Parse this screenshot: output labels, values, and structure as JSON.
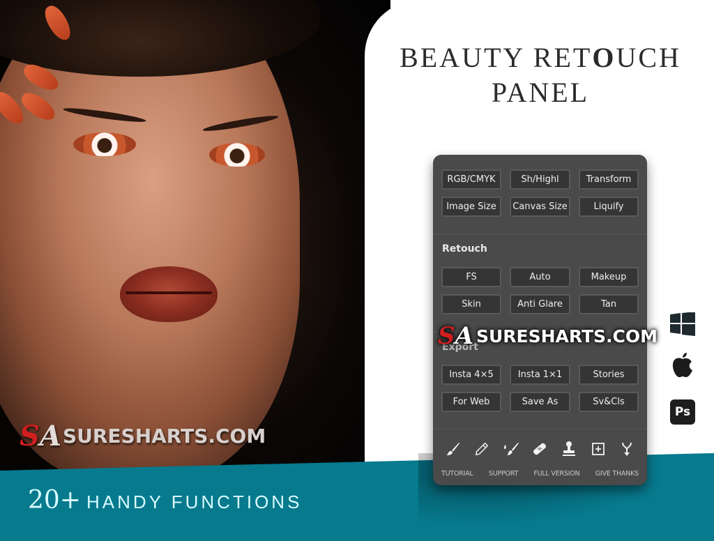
{
  "header": {
    "title_line1_pre": "BEAUTY RET",
    "title_line1_bold": "O",
    "title_line1_post": "UCH",
    "title_line2": "PANEL"
  },
  "panel": {
    "top_buttons": [
      "RGB/CMYK",
      "Sh/Highl",
      "Transform",
      "Image Size",
      "Canvas Size",
      "Liquify"
    ],
    "retouch": {
      "label": "Retouch",
      "buttons": [
        "FS",
        "Auto",
        "Makeup",
        "Skin",
        "Anti Glare",
        "Tan"
      ]
    },
    "export": {
      "label": "Export",
      "buttons": [
        "Insta 4×5",
        "Insta 1×1",
        "Stories",
        "For Web",
        "Save As",
        "Sv&Cls"
      ]
    },
    "tool_icons": [
      "brush-icon",
      "pencil-icon",
      "brush-drop-icon",
      "bandage-icon",
      "stamp-icon",
      "plus-square-icon",
      "fork-arrow-icon"
    ],
    "footer_links": [
      "TUTORIAL",
      "SUPPORT",
      "FULL VERSION",
      "GIVE THANKS"
    ]
  },
  "platforms": [
    "windows-icon",
    "apple-icon",
    "photoshop-icon"
  ],
  "platform_ps_label": "Ps",
  "watermark": {
    "logo_s": "S",
    "logo_a": "A",
    "text": "SURESHARTS.COM"
  },
  "tagline": {
    "number": "20+",
    "text": "HANDY FUNCTIONS"
  },
  "colors": {
    "teal_band": "#077a8e",
    "panel_bg": "#4a4a4a",
    "button_bg": "#353535",
    "tagline_text": "#d9fbff"
  }
}
